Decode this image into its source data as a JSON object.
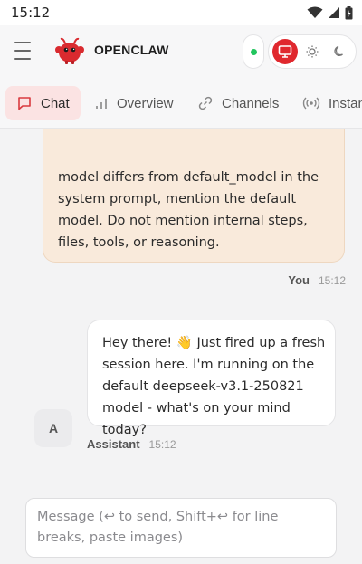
{
  "status_bar": {
    "time": "15:12"
  },
  "header": {
    "brand": "OPENCLAW",
    "status_color": "#22c55e",
    "accent_color": "#e0282e"
  },
  "tabs": [
    {
      "label": "Chat",
      "icon": "chat-bubble-icon",
      "active": true
    },
    {
      "label": "Overview",
      "icon": "bar-chart-icon",
      "active": false
    },
    {
      "label": "Channels",
      "icon": "link-icon",
      "active": false
    },
    {
      "label": "Instan",
      "icon": "broadcast-icon",
      "active": false
    }
  ],
  "messages": {
    "user": {
      "text": "model differs from default_model in the system prompt, mention the default model. Do not mention internal steps, files, tools, or reasoning.",
      "sender": "You",
      "time": "15:12"
    },
    "assistant": {
      "text": "Hey there! 👋 Just fired up a fresh session here. I'm running on the default deepseek-v3.1-250821 model - what's on your mind today?",
      "sender": "Assistant",
      "time": "15:12",
      "avatar_letter": "A"
    }
  },
  "composer": {
    "placeholder": "Message (↩ to send, Shift+↩ for line breaks, paste images)",
    "value": ""
  }
}
